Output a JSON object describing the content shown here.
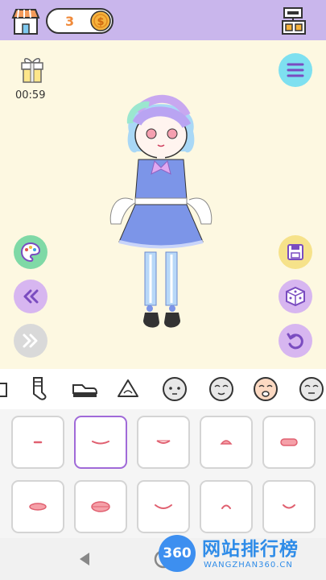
{
  "topbar": {
    "coins": "3",
    "coin_symbol": "$",
    "shop_icon": "shop-icon",
    "settings_icon": "clear-room-icon"
  },
  "stage": {
    "gift_icon": "gift-icon",
    "timer": "00:59",
    "left_buttons": [
      "palette-icon",
      "rewind-icon",
      "fast-forward-icon"
    ],
    "right_buttons": [
      "menu-icon",
      "save-icon",
      "dice-icon",
      "undo-icon"
    ]
  },
  "category_tabs": [
    "partial-tab",
    "socks-icon",
    "shoes-icon",
    "nose-icon",
    "face-icon",
    "mouth-face-icon",
    "skin-face-icon",
    "face-outline-icon"
  ],
  "selected_tab_index": 6,
  "mouth_options": {
    "selected_index": 1,
    "items": [
      "mouth-1",
      "mouth-2",
      "mouth-3",
      "mouth-4",
      "mouth-5",
      "mouth-6",
      "mouth-7",
      "mouth-8",
      "mouth-9",
      "mouth-10"
    ]
  },
  "navbar": {
    "back_icon": "back-triangle-icon",
    "home_icon": "home-circle-icon"
  },
  "watermark": {
    "logo_text": "360",
    "title": "网站排行榜",
    "url": "WANGZHAN360.CN"
  },
  "colors": {
    "topbar": "#c9b6ec",
    "stage": "#fdf8e1",
    "selected_border": "#a06ad8",
    "coin": "#f08a3a"
  }
}
